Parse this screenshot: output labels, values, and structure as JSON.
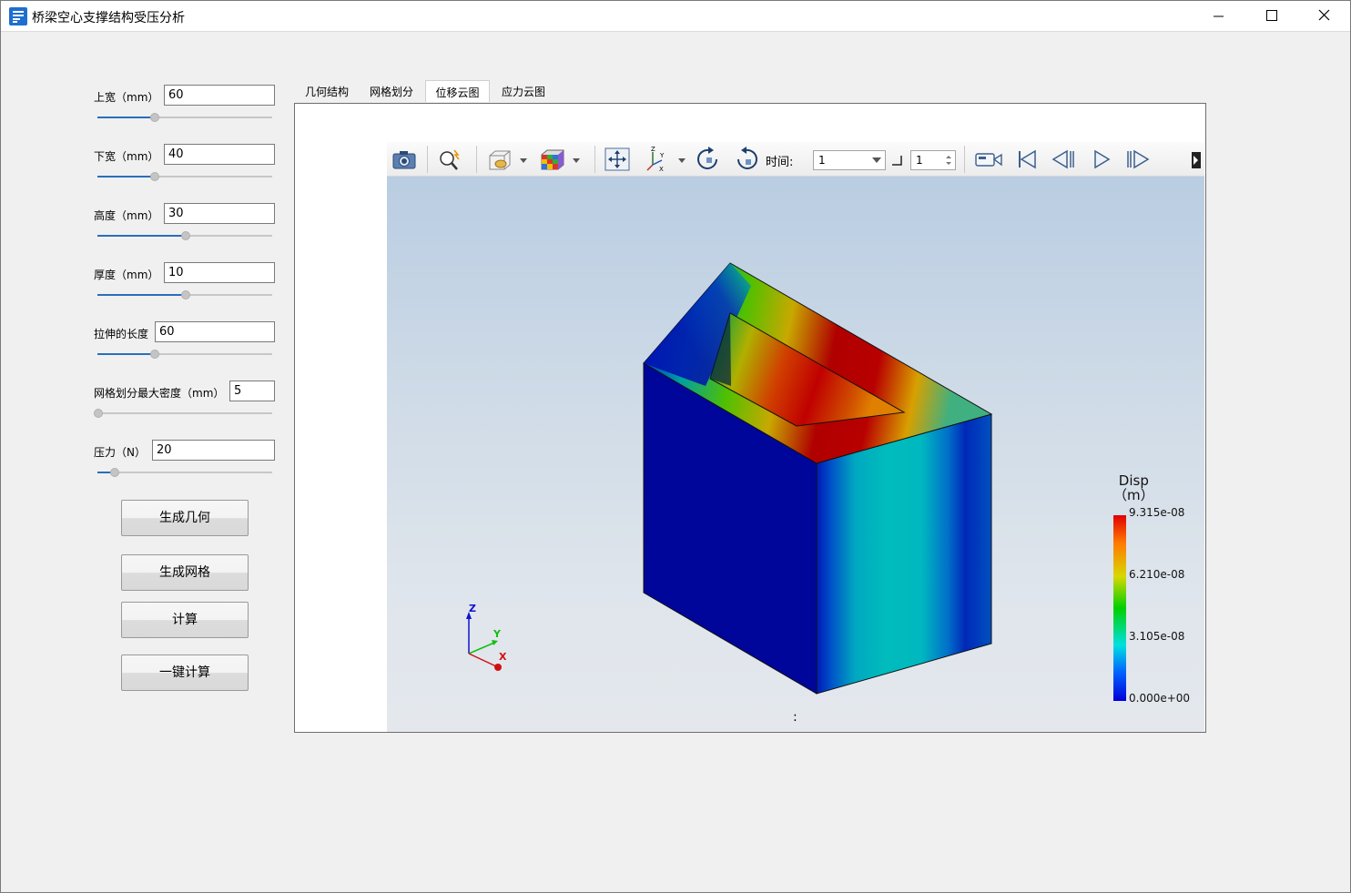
{
  "window": {
    "title": "桥梁空心支撑结构受压分析"
  },
  "params": [
    {
      "label": "上宽（mm）",
      "value": "60",
      "slider_fraction": 0.33
    },
    {
      "label": "下宽（mm）",
      "value": "40",
      "slider_fraction": 0.33
    },
    {
      "label": "高度（mm）",
      "value": "30",
      "slider_fraction": 0.5
    },
    {
      "label": "厚度（mm）",
      "value": "10",
      "slider_fraction": 0.5
    },
    {
      "label": "拉伸的长度",
      "value": "60",
      "slider_fraction": 0.33
    },
    {
      "label": "网格划分最大密度（mm）",
      "value": "5",
      "slider_fraction": 0.0
    },
    {
      "label": "压力（N）",
      "value": "20",
      "slider_fraction": 0.09
    }
  ],
  "buttons": {
    "generate_geometry": "生成几何",
    "generate_mesh": "生成网格",
    "compute": "计算",
    "one_click_compute": "一键计算"
  },
  "tabs": [
    {
      "label": "几何结构",
      "active": false
    },
    {
      "label": "网格划分",
      "active": false
    },
    {
      "label": "位移云图",
      "active": true
    },
    {
      "label": "应力云图",
      "active": false
    }
  ],
  "toolbar": {
    "time_label": "时间:",
    "time_value": "1",
    "step_value": "1",
    "icons": [
      "camera-icon",
      "zoom-fit-icon",
      "view-box-icon",
      "color-cube-icon",
      "pan-icon",
      "axes-icon",
      "rotate-cw-icon",
      "rotate-ccw-icon",
      "record-icon",
      "first-frame-icon",
      "prev-frame-icon",
      "play-icon",
      "next-frame-icon",
      "more-icon"
    ]
  },
  "legend": {
    "title": "Disp\n（m）",
    "labels": [
      "9.315e-08",
      "6.210e-08",
      "3.105e-08",
      "0.000e+00"
    ],
    "colors": [
      "#e00000",
      "#ff7a00",
      "#d8d800",
      "#00d000",
      "#00e0e0",
      "#0060ff",
      "#0000d8"
    ]
  },
  "axes": {
    "x": "X",
    "y": "Y",
    "z": "Z"
  },
  "status": ":"
}
